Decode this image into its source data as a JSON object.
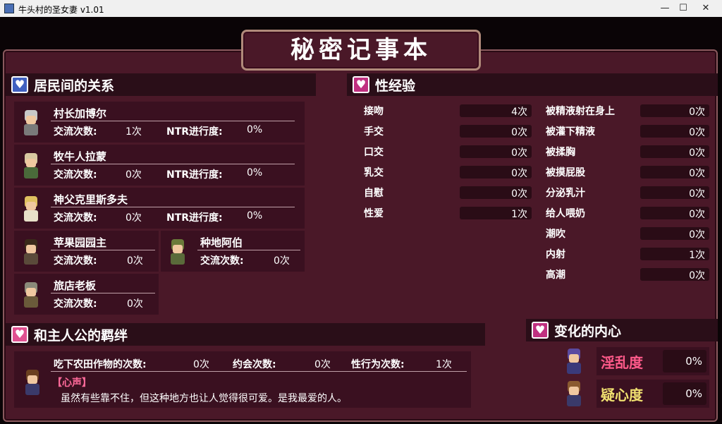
{
  "window": {
    "title": "牛头村的圣女妻 v1.01",
    "minimize": "—",
    "maximize": "☐",
    "close": "✕"
  },
  "header": {
    "title": "秘密记事本"
  },
  "relations": {
    "title": "居民间的关系",
    "icon": "heart-icon",
    "exchange_label": "交流次数:",
    "ntr_label": "NTR进行度:",
    "villagers": [
      {
        "name": "村长加博尔",
        "exchange": "1次",
        "ntr": "0%"
      },
      {
        "name": "牧牛人拉蒙",
        "exchange": "0次",
        "ntr": "0%"
      },
      {
        "name": "神父克里斯多夫",
        "exchange": "0次",
        "ntr": "0%"
      },
      {
        "name": "苹果园园主",
        "exchange": "0次"
      },
      {
        "name": "种地阿伯",
        "exchange": "0次"
      },
      {
        "name": "旅店老板",
        "exchange": "0次"
      }
    ]
  },
  "experience": {
    "title": "性经验",
    "icon": "hearts-icon",
    "left": [
      {
        "label": "接吻",
        "value": "4次"
      },
      {
        "label": "手交",
        "value": "0次"
      },
      {
        "label": "口交",
        "value": "0次"
      },
      {
        "label": "乳交",
        "value": "0次"
      },
      {
        "label": "自慰",
        "value": "0次"
      },
      {
        "label": "性爱",
        "value": "1次"
      }
    ],
    "right": [
      {
        "label": "被精液射在身上",
        "value": "0次"
      },
      {
        "label": "被灌下精液",
        "value": "0次"
      },
      {
        "label": "被揉胸",
        "value": "0次"
      },
      {
        "label": "被摸屁股",
        "value": "0次"
      },
      {
        "label": "分泌乳汁",
        "value": "0次"
      },
      {
        "label": "给人喂奶",
        "value": "0次"
      },
      {
        "label": "潮吹",
        "value": "0次"
      },
      {
        "label": "内射",
        "value": "1次"
      },
      {
        "label": "高潮",
        "value": "0次"
      }
    ]
  },
  "bond": {
    "title": "和主人公的羁绊",
    "icon": "heart-icon",
    "farm_label": "吃下农田作物的次数:",
    "farm_value": "0次",
    "date_label": "约会次数:",
    "date_value": "0次",
    "sex_label": "性行为次数:",
    "sex_value": "1次",
    "voice_tag": "【心声】",
    "voice_text": "虽然有些靠不住，但这种地方也让人觉得很可爱。是我最爱的人。"
  },
  "mind": {
    "title": "变化的内心",
    "icon": "hearts-icon",
    "lewd_label": "淫乱度",
    "lewd_value": "0%",
    "suspicion_label": "疑心度",
    "suspicion_value": "0%",
    "colors": {
      "lewd": "#ff5a8a",
      "suspicion": "#f0e070"
    }
  }
}
